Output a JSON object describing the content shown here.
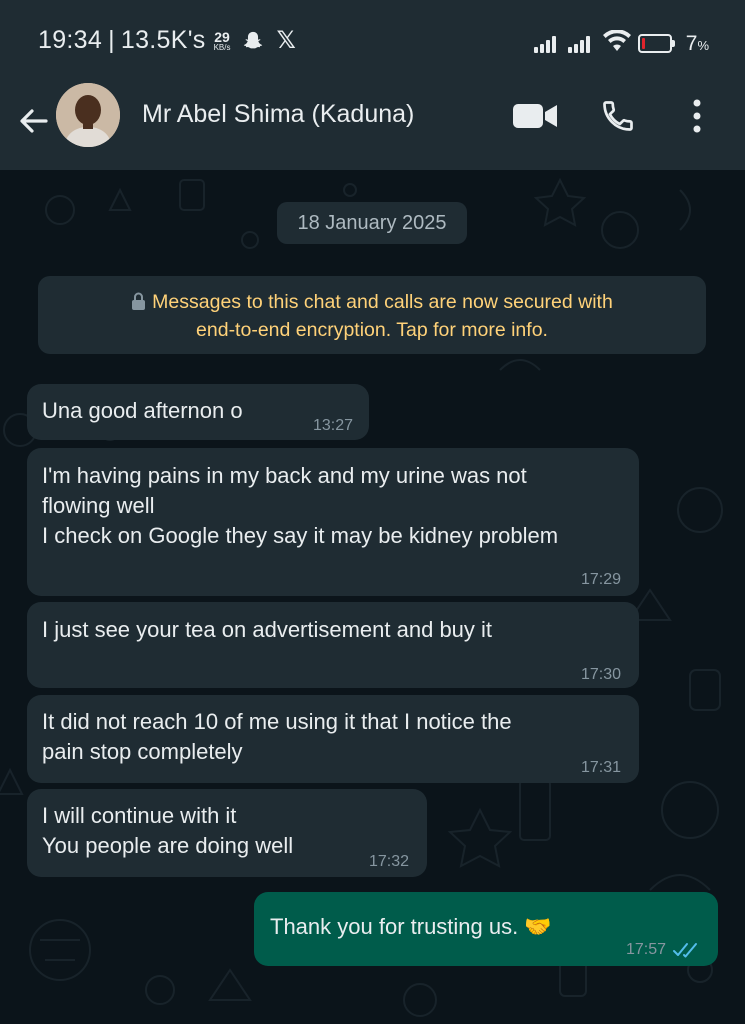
{
  "status_bar": {
    "time": "19:34",
    "separator": "|",
    "views": "13.5K's",
    "speed_value": "29",
    "speed_unit": "KB/s",
    "battery_percent": "7",
    "battery_unit": "%",
    "battery_level": 0.07,
    "battery_color": "#e0242c"
  },
  "header": {
    "contact_name": "Mr Abel Shima (Kaduna)",
    "icons": [
      "back-arrow-icon",
      "avatar",
      "video-call-icon",
      "voice-call-icon",
      "more-options-icon"
    ]
  },
  "chat": {
    "date": "18 January 2025",
    "encryption_notice_line1": "Messages to this chat and calls are now secured with",
    "encryption_notice_line2": "end-to-end encryption. Tap for more info.",
    "messages": [
      {
        "direction": "in",
        "text": "Una good afternon o",
        "time": "13:27"
      },
      {
        "direction": "in",
        "text": "I'm having pains in my back and my urine was not\nflowing well\nI check on Google they say it may be kidney problem",
        "time": "17:29"
      },
      {
        "direction": "in",
        "text": "I just see your tea on advertisement and buy it",
        "time": "17:30"
      },
      {
        "direction": "in",
        "text": "It did not reach 10 of me using it that I notice the\npain stop completely",
        "time": "17:31"
      },
      {
        "direction": "in",
        "text": "I will continue with it\nYou people are doing well",
        "time": "17:32"
      },
      {
        "direction": "out",
        "text": "Thank you for trusting us. 🤝",
        "time": "17:57",
        "status": "read"
      }
    ]
  },
  "colors": {
    "header_bg": "#1f2c33",
    "chat_bg": "#0b141a",
    "incoming_bubble": "#1f2c33",
    "outgoing_bubble": "#005c4b",
    "notice_text": "#ffd279",
    "read_ticks": "#53bdeb"
  }
}
